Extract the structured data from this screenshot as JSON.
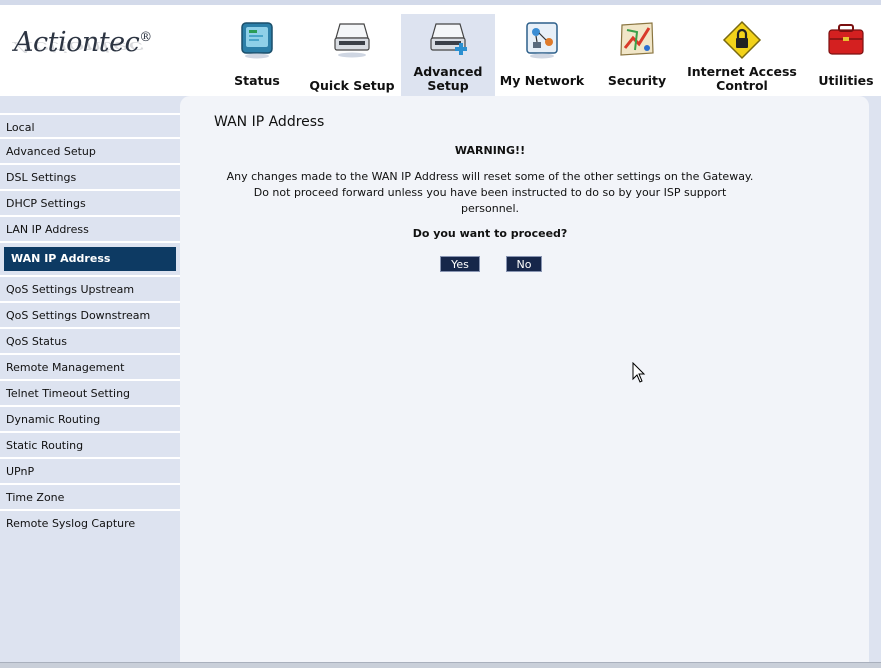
{
  "logo": {
    "text": "Actiontec",
    "reg": "®"
  },
  "nav": [
    {
      "label": "Status",
      "icon": "monitor-icon"
    },
    {
      "label": "Quick Setup",
      "icon": "scanner-icon"
    },
    {
      "label": "Advanced Setup",
      "icon": "scanner-plus-icon",
      "active": true
    },
    {
      "label": "My Network",
      "icon": "network-icon"
    },
    {
      "label": "Security",
      "icon": "shield-map-icon"
    },
    {
      "label": "Internet Access Control",
      "icon": "lock-sign-icon"
    },
    {
      "label": "Utilities",
      "icon": "toolbox-icon"
    }
  ],
  "sidebar": {
    "items": [
      "Local",
      "Advanced Setup",
      "DSL Settings",
      "DHCP Settings",
      "LAN IP Address",
      "WAN IP Address",
      "QoS Settings Upstream",
      "QoS Settings Downstream",
      "QoS Status",
      "Remote Management",
      "Telnet Timeout Setting",
      "Dynamic Routing",
      "Static Routing",
      "UPnP",
      "Time Zone",
      "Remote Syslog Capture"
    ],
    "active_index": 5
  },
  "main": {
    "title": "WAN IP Address",
    "warning_title": "WARNING!!",
    "warning_line1": "Any changes made to the WAN IP Address will reset some of the other settings on the Gateway.",
    "warning_line2": "Do not proceed forward unless you have been instructed to do so by your ISP support",
    "warning_line3": "personnel.",
    "question": "Do you want to proceed?",
    "yes_label": "Yes",
    "no_label": "No"
  },
  "colors": {
    "accent": "#0d3a63",
    "button_bg": "#16264a",
    "page_bg": "#dde3f0",
    "content_bg": "#f2f4f9"
  }
}
